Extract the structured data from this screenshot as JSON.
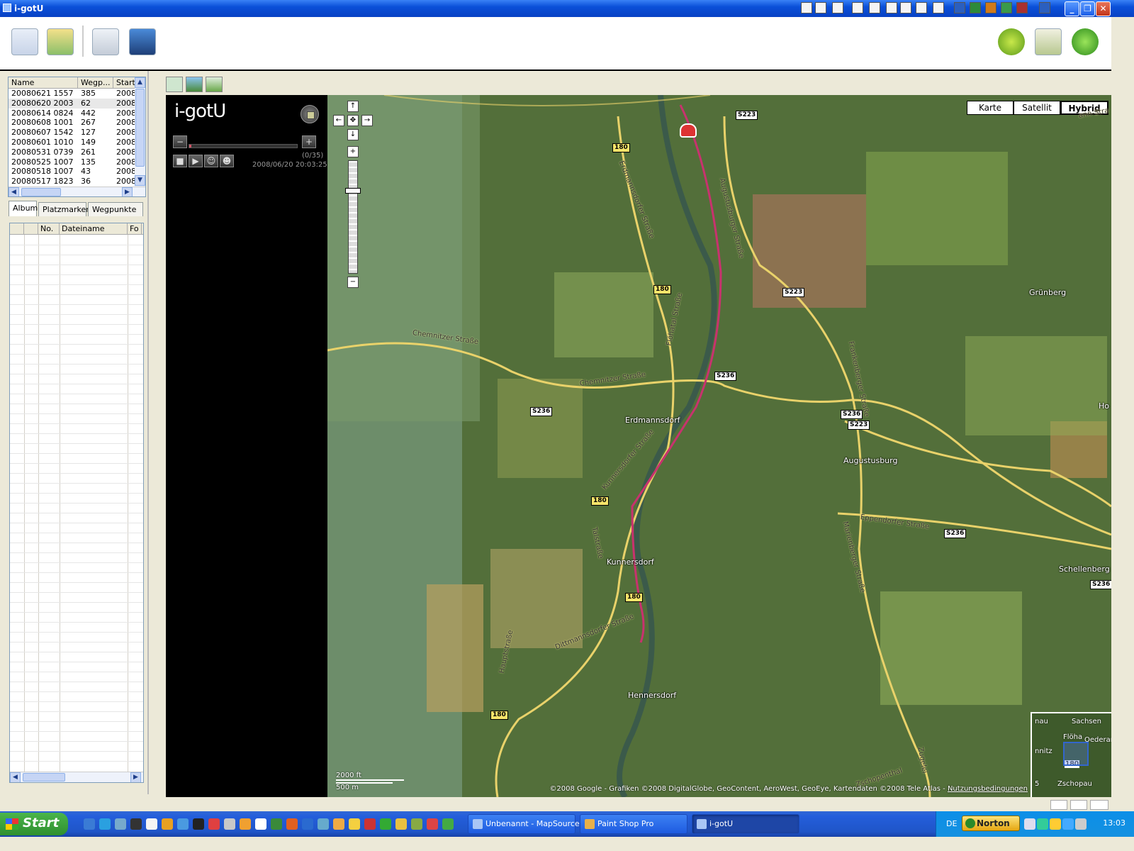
{
  "window": {
    "title": "i-gotU"
  },
  "tracks": {
    "columns": [
      "Name",
      "Wegp...",
      "Start"
    ],
    "rows": [
      {
        "name": "20080621 1557",
        "waypoints": "385",
        "start": "2008"
      },
      {
        "name": "20080620 2003",
        "waypoints": "62",
        "start": "2008"
      },
      {
        "name": "20080614 0824",
        "waypoints": "442",
        "start": "2008"
      },
      {
        "name": "20080608 1001",
        "waypoints": "267",
        "start": "2008"
      },
      {
        "name": "20080607 1542",
        "waypoints": "127",
        "start": "2008"
      },
      {
        "name": "20080601 1010",
        "waypoints": "149",
        "start": "2008"
      },
      {
        "name": "20080531 0739",
        "waypoints": "261",
        "start": "2008"
      },
      {
        "name": "20080525 1007",
        "waypoints": "135",
        "start": "2008"
      },
      {
        "name": "20080518 1007",
        "waypoints": "43",
        "start": "2008"
      },
      {
        "name": "20080517 1823",
        "waypoints": "36",
        "start": "2008"
      }
    ],
    "selected_index": 1
  },
  "tabs": [
    "Album",
    "Platzmarken",
    "Wegpunkte"
  ],
  "album": {
    "columns": [
      "",
      "",
      "No.",
      "Dateiname",
      "Fo"
    ]
  },
  "player": {
    "logo": "i-gotU",
    "counter": "(0/35)",
    "timestamp": "2008/06/20 20:03:25",
    "progress": 0.02,
    "minus": "−",
    "plus": "+"
  },
  "map": {
    "types": [
      "Karte",
      "Satellit",
      "Hybrid"
    ],
    "active_type": "Hybrid",
    "places": [
      "Grünberg",
      "Erdmannsdorf",
      "Augustusburg",
      "Kunnersdorf",
      "Hennersdorf",
      "Schellenberg",
      "Ho"
    ],
    "roads": [
      "S223",
      "180",
      "180",
      "S223",
      "S236",
      "S236",
      "S236",
      "S223",
      "180",
      "S236",
      "180",
      "180",
      "S236"
    ],
    "streets": [
      "Chemnitzer Straße",
      "Chemnitzer Straße",
      "Erdmannsdorfer Straße",
      "Augustusburger Straße",
      "Flöhatal Straße",
      "Kunnersdorfer Straße",
      "Talstraße",
      "Dittmannsdorfer Straße",
      "Hauptstraße",
      "Frankenberger Straße",
      "Marienberger Straße",
      "Eppendorfer Straße",
      "Zschopenthal",
      "Zugelei",
      "ann-Stra"
    ],
    "scale": {
      "ft": "2000 ft",
      "m": "500 m"
    },
    "copyright": "©2008 Google - Grafiken ©2008 DigitalGlobe, GeoContent, AeroWest, GeoEye, Kartendaten ©2008 Tele Atlas - ",
    "terms": "Nutzungsbedingungen",
    "overview": [
      "nau",
      "Sachsen",
      "Flöha",
      "Oederan",
      "nnitz",
      "180",
      "Zschopau",
      "5"
    ]
  },
  "taskbar": {
    "start": "Start",
    "tasks": [
      "Unbenannt - MapSource",
      "Paint Shop Pro",
      "i-gotU"
    ],
    "lang": "DE",
    "norton": "Norton",
    "clock": "13:03"
  }
}
